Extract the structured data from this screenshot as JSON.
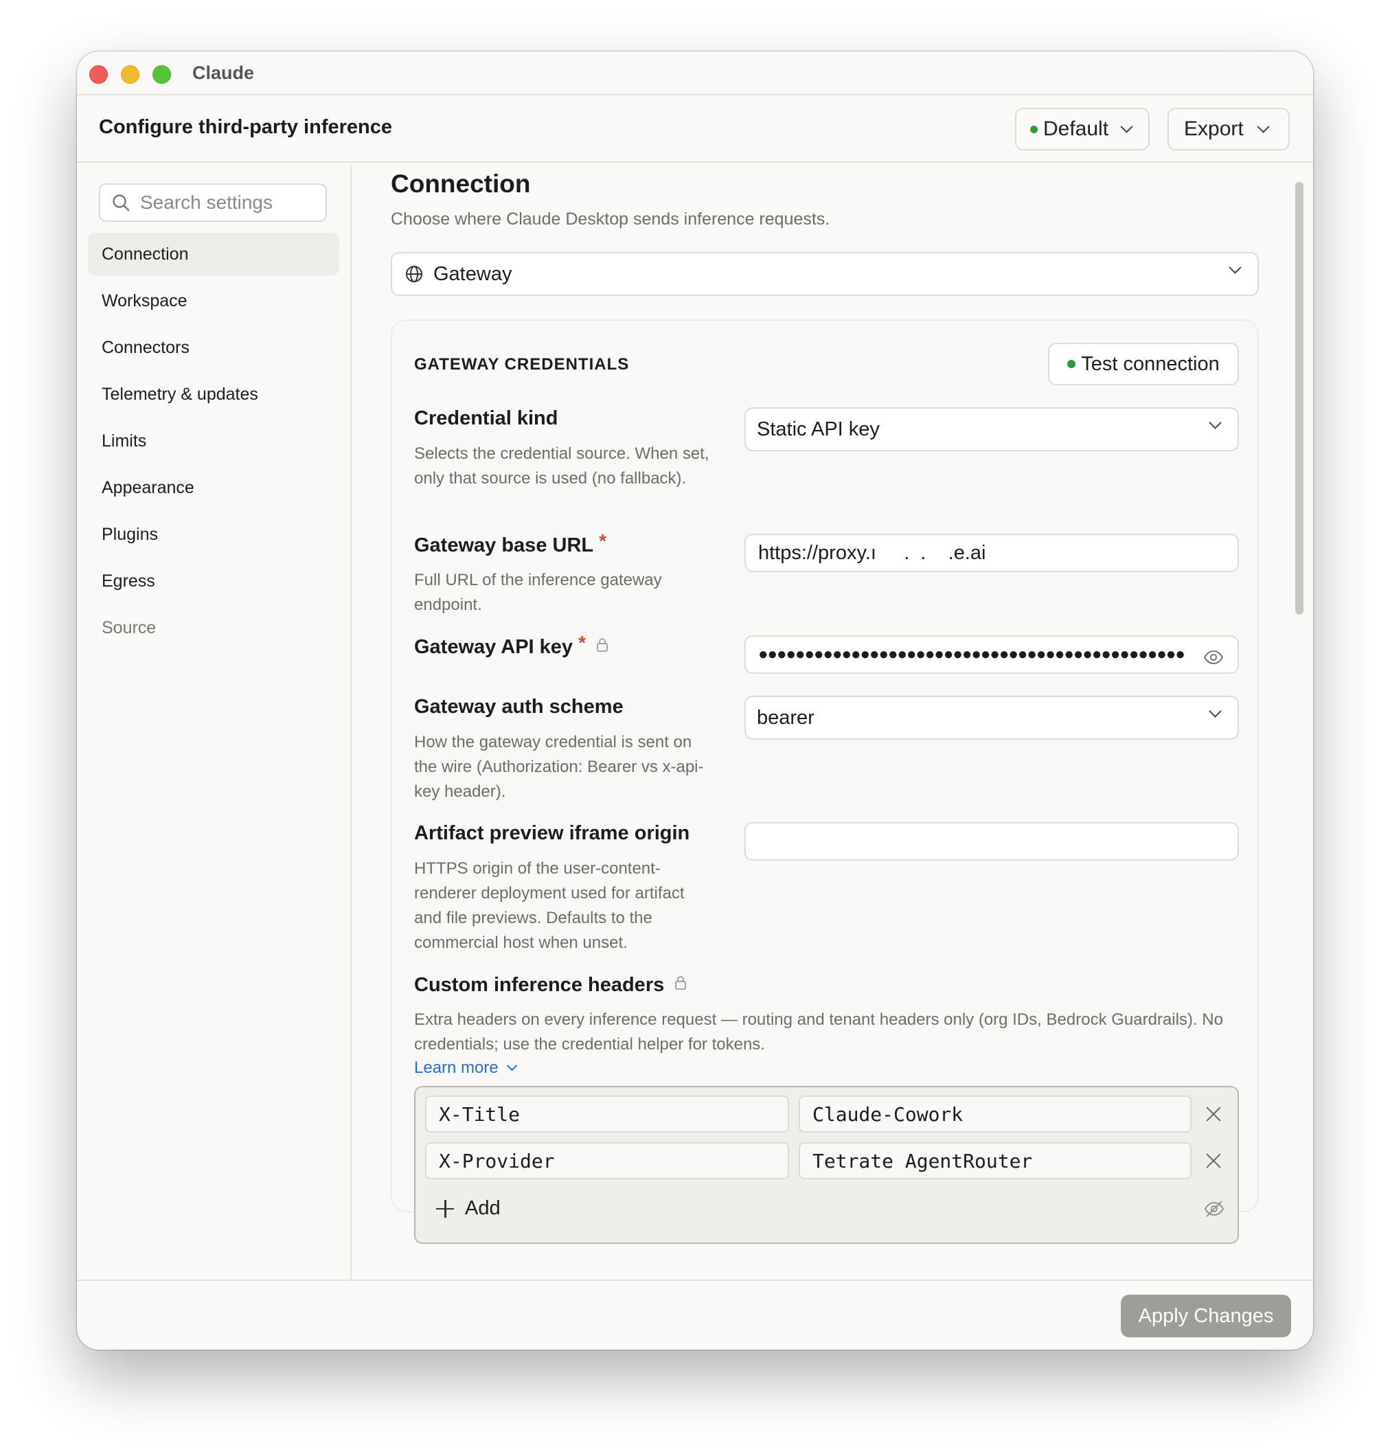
{
  "window": {
    "title": "Claude"
  },
  "header": {
    "title": "Configure third-party inference",
    "profile_label": "Default",
    "export_label": "Export"
  },
  "sidebar": {
    "search_placeholder": "Search settings",
    "items": [
      {
        "label": "Connection"
      },
      {
        "label": "Workspace"
      },
      {
        "label": "Connectors"
      },
      {
        "label": "Telemetry & updates"
      },
      {
        "label": "Limits"
      },
      {
        "label": "Appearance"
      },
      {
        "label": "Plugins"
      },
      {
        "label": "Egress"
      },
      {
        "label": "Source"
      }
    ],
    "active_index": 0
  },
  "connection": {
    "title": "Connection",
    "subtitle": "Choose where Claude Desktop sends inference requests.",
    "provider_value": "Gateway"
  },
  "credentials": {
    "section_title": "GATEWAY CREDENTIALS",
    "test_button": "Test connection",
    "credential_kind": {
      "label": "Credential kind",
      "description": "Selects the credential source. When set, only that source is used (no fallback).",
      "value": "Static API key"
    },
    "base_url": {
      "label": "Gateway base URL",
      "required_mark": "*",
      "description": "Full URL of the inference gateway endpoint.",
      "value": "https://proxy.ı     .  .    .e.ai"
    },
    "api_key": {
      "label": "Gateway API key",
      "required_mark": "*",
      "value_masked": "●●●●●●●●●●●●●●●●●●●●●●●●●●●●●●●●●●●●●●●●●●●●●●●●●●"
    },
    "auth_scheme": {
      "label": "Gateway auth scheme",
      "description": "How the gateway credential is sent on the wire (Authorization: Bearer vs x-api-key header).",
      "value": "bearer"
    },
    "iframe_origin": {
      "label": "Artifact preview iframe origin",
      "description": "HTTPS origin of the user-content-renderer deployment used for artifact and file previews. Defaults to the commercial host when unset.",
      "value": ""
    },
    "custom_headers": {
      "label": "Custom inference headers",
      "description": "Extra headers on every inference request — routing and tenant headers only (org IDs, Bedrock Guardrails). No credentials; use the credential helper for tokens.",
      "learn_more": "Learn more",
      "rows": [
        {
          "key": "X-Title",
          "value": "Claude-Cowork"
        },
        {
          "key": "X-Provider",
          "value": "Tetrate AgentRouter"
        }
      ],
      "add_label": "Add"
    }
  },
  "footer": {
    "apply_label": "Apply Changes"
  },
  "colors": {
    "status_green": "#2f9a3a",
    "link_blue": "#2b6cc4",
    "required_red": "#c8503b",
    "apply_disabled": "#9e9d9a"
  }
}
